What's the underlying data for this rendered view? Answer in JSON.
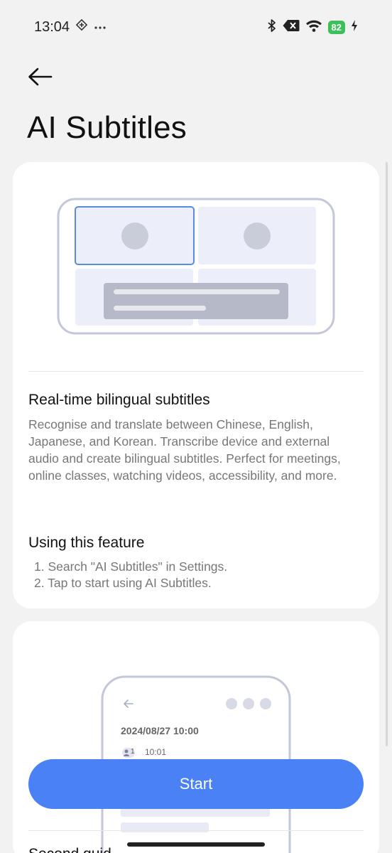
{
  "status_bar": {
    "time": "13:04",
    "left_icons": [
      "navigation-diamond-icon",
      "more-dots-icon"
    ],
    "right_icons": [
      "bluetooth-icon",
      "mute-x-icon",
      "wifi-icon",
      "battery-icon",
      "charging-bolt-icon"
    ],
    "battery_level": "82",
    "battery_color": "#3cc05a"
  },
  "header": {
    "back_icon": "arrow-left-icon",
    "title": "AI Subtitles"
  },
  "feature_card": {
    "illustration": "split-screen-video-call-illustration",
    "title": "Real-time bilingual subtitles",
    "description": "Recognise and translate between Chinese, English, Japanese, and Korean. Transcribe device and external audio and create bilingual subtitles. Perfect for meetings, online classes, watching videos, accessibility, and more.",
    "usage_title": "Using this feature",
    "steps": [
      "1. Search \"AI Subtitles\" in Settings.",
      "2. Tap to start using AI Subtitles."
    ]
  },
  "second_card": {
    "illustration": "phone-transcript-illustration",
    "mock_date": "2024/08/27 10:00",
    "mock_speaker": "1",
    "mock_time": "10:01",
    "partial_heading": "Second guid"
  },
  "start_button": {
    "label": "Start",
    "color": "#4a82f5"
  }
}
